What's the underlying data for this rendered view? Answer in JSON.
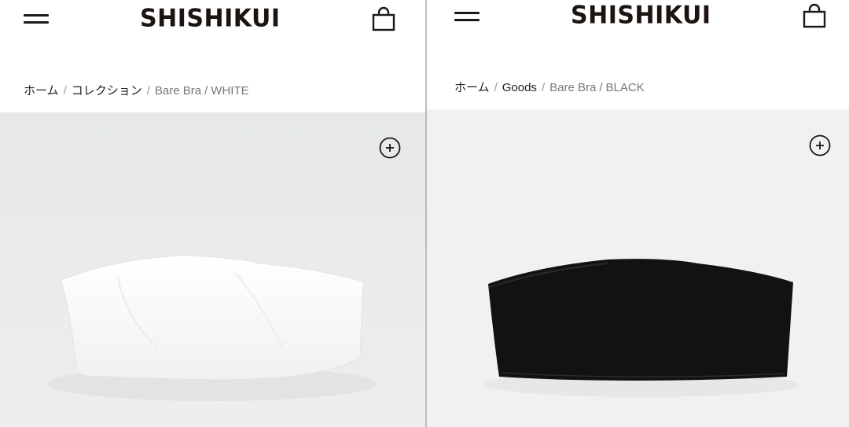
{
  "brand": "SHISHIKUI",
  "panels": [
    {
      "breadcrumb": {
        "home": "ホーム",
        "collection": "コレクション",
        "product": "Bare Bra",
        "variant": "WHITE"
      },
      "product_color": "#f6f6f4",
      "background_color": "#e9ebea"
    },
    {
      "breadcrumb": {
        "home": "ホーム",
        "collection": "Goods",
        "product": "Bare Bra",
        "variant": "BLACK"
      },
      "product_color": "#111111",
      "background_color": "#f0f0ef"
    }
  ],
  "separators": {
    "slash": "/"
  },
  "icons": {
    "menu": "hamburger-menu-icon",
    "cart": "shopping-bag-icon",
    "zoom": "zoom-plus-icon"
  },
  "colors": {
    "text": "#1a1a1a",
    "muted": "#777777"
  }
}
